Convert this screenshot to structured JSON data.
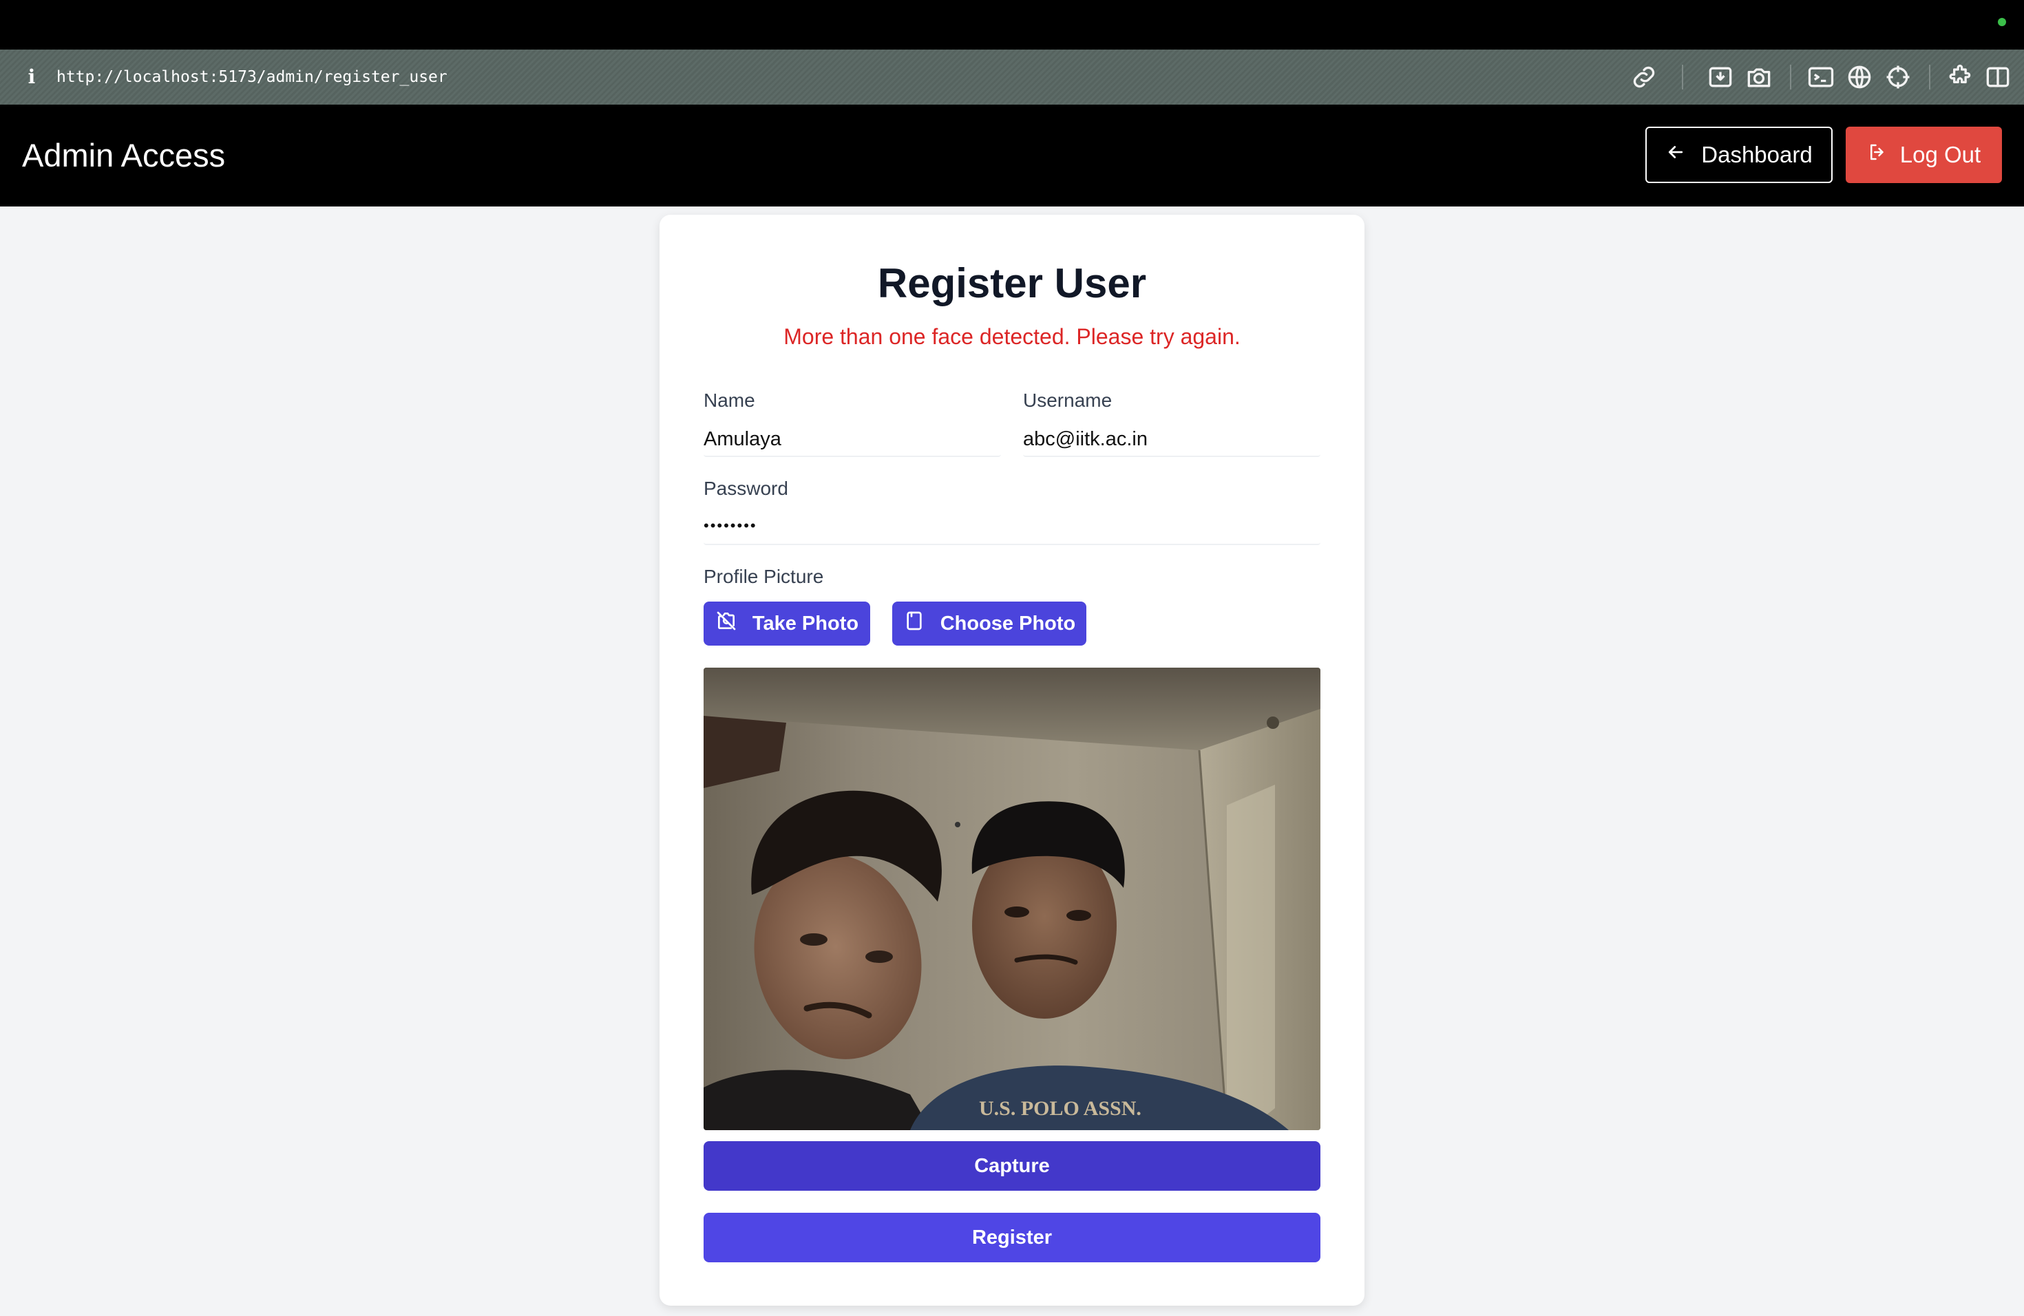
{
  "browser": {
    "info_label": "i",
    "url": "http://localhost:5173/admin/register_user",
    "toolbar_icons": [
      "link-icon",
      "download-icon",
      "camera-icon",
      "terminal-icon",
      "globe-icon",
      "crosshair-icon",
      "extensions-icon",
      "sidebar-icon"
    ],
    "status_dot_color": "#3bbf4a"
  },
  "header": {
    "title": "Admin Access",
    "dashboard_label": "Dashboard",
    "logout_label": "Log Out",
    "logout_color": "#e0483f"
  },
  "form": {
    "title": "Register User",
    "error_message": "More than one face detected. Please try again.",
    "error_color": "#dc2626",
    "name_label": "Name",
    "name_value": "Amulaya",
    "username_label": "Username",
    "username_value": "abc@iitk.ac.in",
    "password_label": "Password",
    "password_value": "••••••••",
    "profile_label": "Profile Picture",
    "take_photo_label": "Take Photo",
    "choose_photo_label": "Choose Photo",
    "capture_label": "Capture",
    "register_label": "Register",
    "accent_color": "#4b44dc"
  }
}
